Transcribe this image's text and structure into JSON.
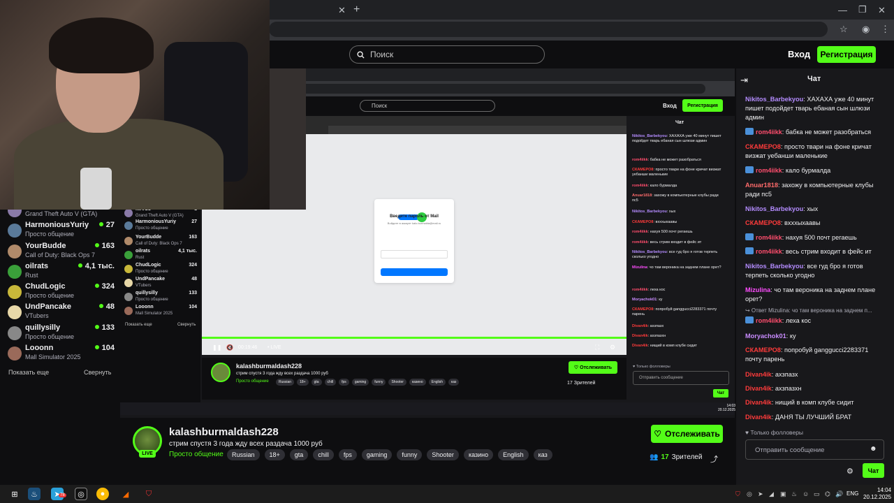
{
  "browser": {
    "tab_close": "✕",
    "new_tab": "+",
    "window_controls": [
      "—",
      "❐",
      "✕"
    ],
    "icons": [
      "star-icon",
      "account-icon",
      "menu-icon"
    ]
  },
  "header": {
    "search_placeholder": "Поиск",
    "login_label": "Вход",
    "register_label": "Регистрация"
  },
  "sidebar": {
    "items": [
      {
        "name": "nirvOz",
        "category": "Grand Theft Auto V (GTA)",
        "viewers": "1",
        "color": "#8a7aa8"
      },
      {
        "name": "HarmoniousYuriy",
        "category": "Просто общение",
        "viewers": "27",
        "color": "#5a7a9a"
      },
      {
        "name": "YourBudde",
        "category": "Call of Duty: Black Ops 7",
        "viewers": "163",
        "color": "#b08a6a"
      },
      {
        "name": "oilrats",
        "category": "Rust",
        "viewers": "4,1 тыс.",
        "color": "#3aa03a"
      },
      {
        "name": "ChudLogic",
        "category": "Просто общение",
        "viewers": "324",
        "color": "#c8b83a"
      },
      {
        "name": "UndPancake",
        "category": "VTubers",
        "viewers": "48",
        "color": "#e8d8a8"
      },
      {
        "name": "quillysilly",
        "category": "Просто общение",
        "viewers": "133",
        "color": "#888888"
      },
      {
        "name": "Looonn",
        "category": "Mall Simulator 2025",
        "viewers": "104",
        "color": "#9a6a5a"
      }
    ],
    "show_more": "Показать еще",
    "collapse": "Свернуть"
  },
  "nested": {
    "search_placeholder": "Поиск",
    "login_label": "Вход",
    "register_label": "Регистрация",
    "chat_title": "Чат",
    "dialog_title": "Введите пароль от Mail",
    "dialog_sub": "Войдите в аккаунт kalo.burmalda@mail.ru",
    "time": "00:19:46",
    "live": "• LIVE",
    "channel": "kalashburmaldash228",
    "title": "стрим спустя 3 года жду всех раздача 1000 руб",
    "category": "Просто общение",
    "tags": [
      "Russian",
      "18+",
      "gta",
      "chill",
      "fps",
      "gaming",
      "funny",
      "Shooter",
      "казино",
      "English",
      "каз"
    ],
    "follow": "♡ Отслеживать",
    "viewers": "17 Зрителей",
    "chat_input": "Отправить сообщение",
    "chat_send": "Чат",
    "followers_only": "♥ Только фолловеры",
    "show_more": "Показать еще",
    "collapse": "Свернуть",
    "clock_time": "14:03",
    "clock_date": "20.12.2025"
  },
  "stream": {
    "channel": "kalashburmaldash228",
    "title": "стрим спустя 3 года жду всех раздача 1000 руб",
    "category": "Просто общение",
    "live_label": "LIVE",
    "tags": [
      "Russian",
      "18+",
      "gta",
      "chill",
      "fps",
      "gaming",
      "funny",
      "Shooter",
      "казино",
      "English",
      "каз"
    ],
    "follow_label": "Отслеживать",
    "viewers_count": "17",
    "viewers_label": "Зрителей"
  },
  "chat": {
    "title": "Чат",
    "messages": [
      {
        "user": "Nikitos_Barbekyou",
        "text": ": ХАХАХА уже 40 минут пишет подойдет тварь ебаная сын шлюзи админ",
        "color": "#b48cff",
        "badge": false
      },
      {
        "user": "rom4iikk",
        "text": ": бабка не может разобраться",
        "color": "#ff4d6d",
        "badge": true
      },
      {
        "user": "СКАМЕРО8",
        "text": ": просто твари на фоне кричат визжат уебанши маленькие",
        "color": "#ff3b3b",
        "badge": false
      },
      {
        "user": "rom4iikk",
        "text": ": кало бурмалда",
        "color": "#ff4d6d",
        "badge": true
      },
      {
        "user": "Anuar1818",
        "text": ": захожу в компьютерные клубы ради пс5",
        "color": "#ff6b6b",
        "badge": false
      },
      {
        "user": "Nikitos_Barbekyou",
        "text": ": хых",
        "color": "#b48cff",
        "badge": false
      },
      {
        "user": "СКАМЕРО8",
        "text": ": вхххыхаавы",
        "color": "#ff3b3b",
        "badge": false
      },
      {
        "user": "rom4iikk",
        "text": ": нахуя 500 почт регаешь",
        "color": "#ff4d6d",
        "badge": true
      },
      {
        "user": "rom4iikk",
        "text": ": весь стрим входит в фейс ит",
        "color": "#ff4d6d",
        "badge": true
      },
      {
        "user": "Nikitos_Barbekyou",
        "text": ": все гуд бро я готов терпеть сколько угодно",
        "color": "#b48cff",
        "badge": false
      },
      {
        "user": "Mizulina",
        "text": ": чо там вероника на заднем плане орет?",
        "color": "#ff4dff",
        "badge": false
      },
      {
        "user": "rom4iikk",
        "text": ": леха кос",
        "color": "#ff4d6d",
        "badge": true
      },
      {
        "user": "Moryachok01",
        "text": ": ку",
        "color": "#c98cff",
        "badge": false
      },
      {
        "user": "СКАМЕРО8",
        "text": ": попробуй gangguccі2283371 почту парень",
        "color": "#ff3b3b",
        "badge": false
      },
      {
        "user": "Divan4ik",
        "text": ": ахзпазх",
        "color": "#ff3b3b",
        "badge": false
      },
      {
        "user": "Divan4ik",
        "text": ": ахзпазхн",
        "color": "#ff3b3b",
        "badge": false
      },
      {
        "user": "Divan4ik",
        "text": ": нищий в комп клубе сидит",
        "color": "#ff3b3b",
        "badge": false
      },
      {
        "user": "Divan4ik",
        "text": ": ДАНЯ ТЫ ЛУЧШИЙ БРАТ",
        "color": "#ff3b3b",
        "badge": false
      }
    ],
    "reply_to": "↪ Ответ Mizulina: чо там вероника на заднем п...",
    "followers_only": "Только фолловеры",
    "input_placeholder": "Отправить сообщение",
    "send_label": "Чат"
  },
  "taskbar": {
    "language": "ENG",
    "time": "14:04",
    "date": "20.12.2025",
    "badge": "78"
  }
}
